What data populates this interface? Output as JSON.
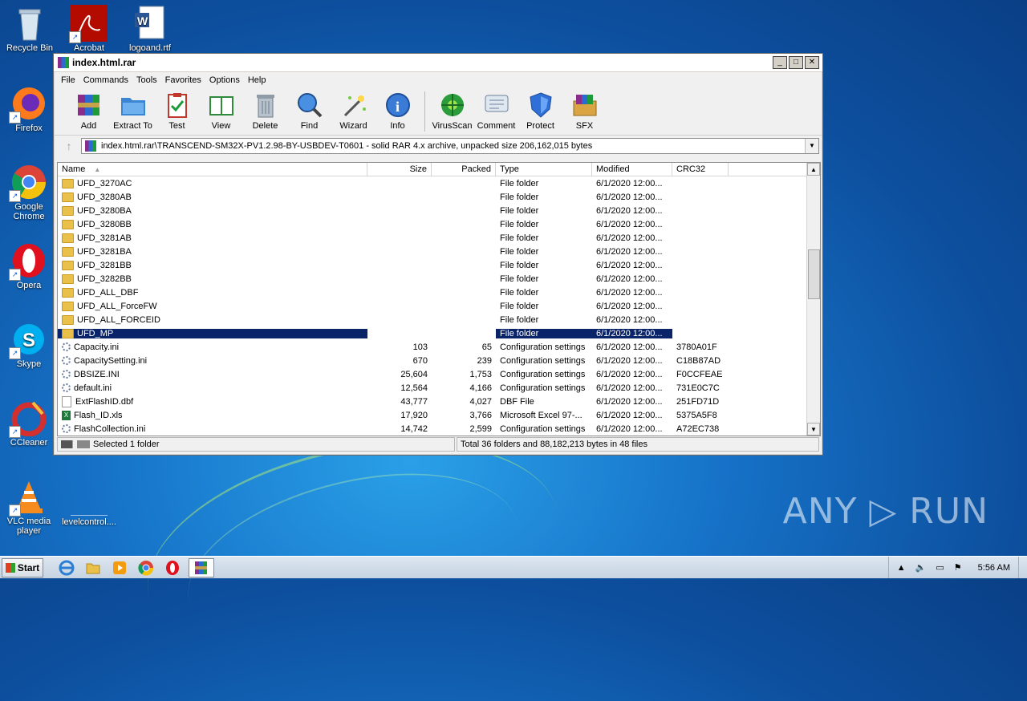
{
  "desktop": {
    "icons": [
      {
        "label": "Recycle Bin",
        "icon": "recycle-bin-icon"
      },
      {
        "label": "Acrobat",
        "icon": "acrobat-icon"
      },
      {
        "label": "logoand.rtf",
        "icon": "word-document-icon"
      },
      {
        "label": "Firefox",
        "icon": "firefox-icon"
      },
      {
        "label": "Google Chrome",
        "icon": "chrome-icon"
      },
      {
        "label": "Opera",
        "icon": "opera-icon"
      },
      {
        "label": "Skype",
        "icon": "skype-icon"
      },
      {
        "label": "CCleaner",
        "icon": "ccleaner-icon"
      },
      {
        "label": "VLC media player",
        "icon": "vlc-icon"
      },
      {
        "label": "levelcontrol....",
        "icon": "blank-file-icon"
      }
    ],
    "watermark": "ANY ▷ RUN"
  },
  "window": {
    "title": "index.html.rar",
    "controls": {
      "minimize": "_",
      "maximize": "□",
      "close": "✕"
    },
    "menu": [
      "File",
      "Commands",
      "Tools",
      "Favorites",
      "Options",
      "Help"
    ],
    "toolbar": [
      {
        "label": "Add",
        "icon": "add-archive-icon"
      },
      {
        "label": "Extract To",
        "icon": "extract-folder-icon"
      },
      {
        "label": "Test",
        "icon": "test-clipboard-icon"
      },
      {
        "label": "View",
        "icon": "view-book-icon"
      },
      {
        "label": "Delete",
        "icon": "delete-trash-icon"
      },
      {
        "label": "Find",
        "icon": "find-magnifier-icon"
      },
      {
        "label": "Wizard",
        "icon": "wizard-wand-icon"
      },
      {
        "label": "Info",
        "icon": "info-icon"
      },
      {
        "label": "VirusScan",
        "icon": "virusscan-icon"
      },
      {
        "label": "Comment",
        "icon": "comment-icon"
      },
      {
        "label": "Protect",
        "icon": "protect-shield-icon"
      },
      {
        "label": "SFX",
        "icon": "sfx-box-icon"
      }
    ],
    "path": "index.html.rar\\TRANSCEND-SM32X-PV1.2.98-BY-USBDEV-T0601 - solid RAR 4.x archive, unpacked size 206,162,015 bytes",
    "columns": [
      "Name",
      "Size",
      "Packed",
      "Type",
      "Modified",
      "CRC32"
    ],
    "files": [
      {
        "name": "UFD_3270AC",
        "size": "",
        "packed": "",
        "type": "File folder",
        "modified": "6/1/2020 12:00...",
        "crc": "",
        "kind": "folder"
      },
      {
        "name": "UFD_3280AB",
        "size": "",
        "packed": "",
        "type": "File folder",
        "modified": "6/1/2020 12:00...",
        "crc": "",
        "kind": "folder"
      },
      {
        "name": "UFD_3280BA",
        "size": "",
        "packed": "",
        "type": "File folder",
        "modified": "6/1/2020 12:00...",
        "crc": "",
        "kind": "folder"
      },
      {
        "name": "UFD_3280BB",
        "size": "",
        "packed": "",
        "type": "File folder",
        "modified": "6/1/2020 12:00...",
        "crc": "",
        "kind": "folder"
      },
      {
        "name": "UFD_3281AB",
        "size": "",
        "packed": "",
        "type": "File folder",
        "modified": "6/1/2020 12:00...",
        "crc": "",
        "kind": "folder"
      },
      {
        "name": "UFD_3281BA",
        "size": "",
        "packed": "",
        "type": "File folder",
        "modified": "6/1/2020 12:00...",
        "crc": "",
        "kind": "folder"
      },
      {
        "name": "UFD_3281BB",
        "size": "",
        "packed": "",
        "type": "File folder",
        "modified": "6/1/2020 12:00...",
        "crc": "",
        "kind": "folder"
      },
      {
        "name": "UFD_3282BB",
        "size": "",
        "packed": "",
        "type": "File folder",
        "modified": "6/1/2020 12:00...",
        "crc": "",
        "kind": "folder"
      },
      {
        "name": "UFD_ALL_DBF",
        "size": "",
        "packed": "",
        "type": "File folder",
        "modified": "6/1/2020 12:00...",
        "crc": "",
        "kind": "folder"
      },
      {
        "name": "UFD_ALL_ForceFW",
        "size": "",
        "packed": "",
        "type": "File folder",
        "modified": "6/1/2020 12:00...",
        "crc": "",
        "kind": "folder"
      },
      {
        "name": "UFD_ALL_FORCEID",
        "size": "",
        "packed": "",
        "type": "File folder",
        "modified": "6/1/2020 12:00...",
        "crc": "",
        "kind": "folder"
      },
      {
        "name": "UFD_MP",
        "size": "",
        "packed": "",
        "type": "File folder",
        "modified": "6/1/2020 12:00...",
        "crc": "",
        "kind": "folder",
        "selected": true
      },
      {
        "name": "Capacity.ini",
        "size": "103",
        "packed": "65",
        "type": "Configuration settings",
        "modified": "6/1/2020 12:00...",
        "crc": "3780A01F",
        "kind": "ini"
      },
      {
        "name": "CapacitySetting.ini",
        "size": "670",
        "packed": "239",
        "type": "Configuration settings",
        "modified": "6/1/2020 12:00...",
        "crc": "C18B87AD",
        "kind": "ini"
      },
      {
        "name": "DBSIZE.INI",
        "size": "25,604",
        "packed": "1,753",
        "type": "Configuration settings",
        "modified": "6/1/2020 12:00...",
        "crc": "F0CCFEAE",
        "kind": "ini"
      },
      {
        "name": "default.ini",
        "size": "12,564",
        "packed": "4,166",
        "type": "Configuration settings",
        "modified": "6/1/2020 12:00...",
        "crc": "731E0C7C",
        "kind": "ini"
      },
      {
        "name": "ExtFlashID.dbf",
        "size": "43,777",
        "packed": "4,027",
        "type": "DBF File",
        "modified": "6/1/2020 12:00...",
        "crc": "251FD71D",
        "kind": "doc"
      },
      {
        "name": "Flash_ID.xls",
        "size": "17,920",
        "packed": "3,766",
        "type": "Microsoft Excel 97-...",
        "modified": "6/1/2020 12:00...",
        "crc": "5375A5F8",
        "kind": "xls"
      },
      {
        "name": "FlashCollection.ini",
        "size": "14,742",
        "packed": "2,599",
        "type": "Configuration settings",
        "modified": "6/1/2020 12:00...",
        "crc": "A72EC738",
        "kind": "ini"
      }
    ],
    "status_left": "Selected 1 folder",
    "status_right": "Total 36 folders and 88,182,213 bytes in 48 files"
  },
  "taskbar": {
    "start_label": "Start",
    "apps": [
      "ie-icon",
      "explorer-icon",
      "media-player-icon",
      "chrome-icon",
      "opera-icon",
      "winrar-icon"
    ],
    "clock": "5:56 AM"
  }
}
